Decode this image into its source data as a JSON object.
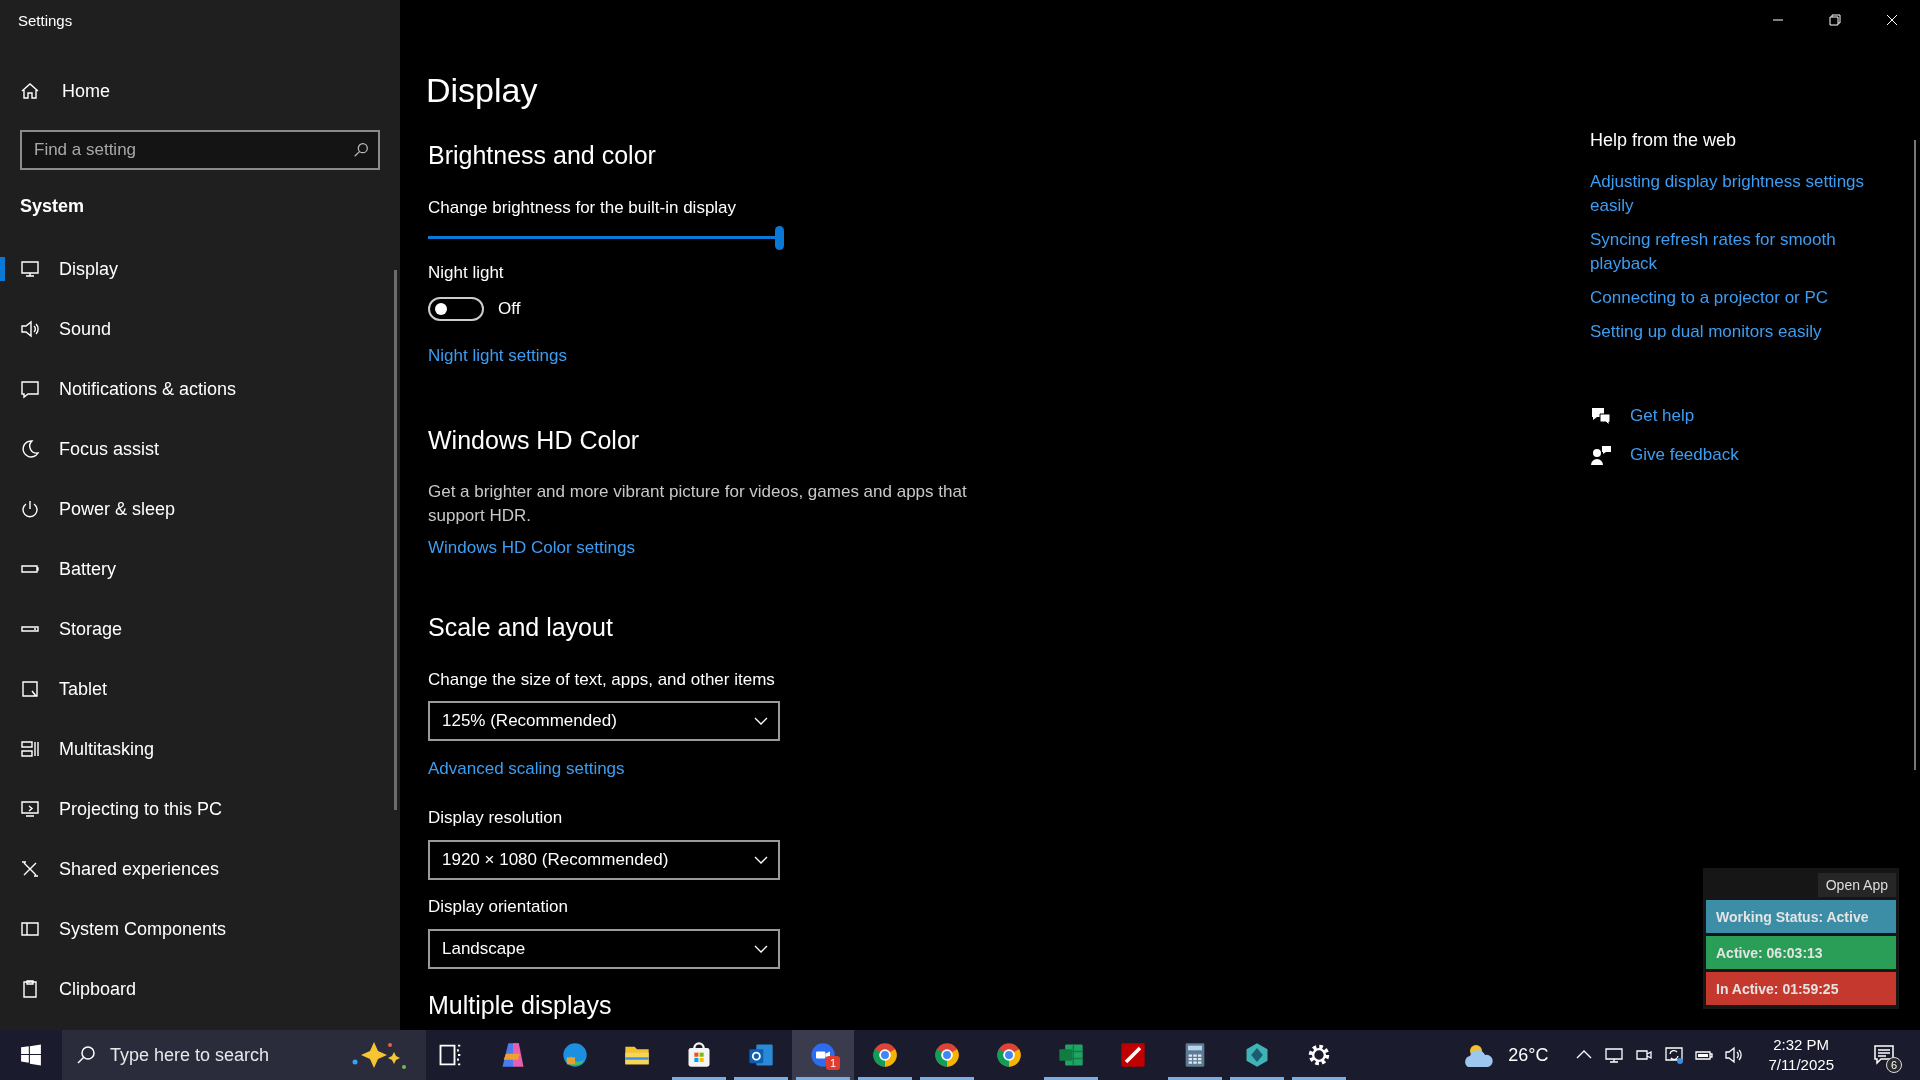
{
  "window": {
    "title": "Settings"
  },
  "sidebar": {
    "home": "Home",
    "search": {
      "placeholder": "Find a setting"
    },
    "section": "System",
    "items": [
      {
        "label": "Display",
        "selected": true
      },
      {
        "label": "Sound",
        "selected": false
      },
      {
        "label": "Notifications & actions",
        "selected": false
      },
      {
        "label": "Focus assist",
        "selected": false
      },
      {
        "label": "Power & sleep",
        "selected": false
      },
      {
        "label": "Battery",
        "selected": false
      },
      {
        "label": "Storage",
        "selected": false
      },
      {
        "label": "Tablet",
        "selected": false
      },
      {
        "label": "Multitasking",
        "selected": false
      },
      {
        "label": "Projecting to this PC",
        "selected": false
      },
      {
        "label": "Shared experiences",
        "selected": false
      },
      {
        "label": "System Components",
        "selected": false
      },
      {
        "label": "Clipboard",
        "selected": false
      }
    ]
  },
  "page": {
    "title": "Display",
    "brightness": {
      "heading": "Brightness and color",
      "label": "Change brightness for the built-in display",
      "level": 1.0
    },
    "night_light": {
      "label": "Night light",
      "on": false,
      "state": "Off",
      "link": "Night light settings"
    },
    "hd_color": {
      "heading": "Windows HD Color",
      "description": "Get a brighter and more vibrant picture for videos, games and apps that support HDR.",
      "link": "Windows HD Color settings"
    },
    "scale": {
      "heading": "Scale and layout",
      "size_label": "Change the size of text, apps, and other items",
      "size_value": "125% (Recommended)",
      "advanced_link": "Advanced scaling settings",
      "resolution_label": "Display resolution",
      "resolution_value": "1920 × 1080 (Recommended)",
      "orientation_label": "Display orientation",
      "orientation_value": "Landscape"
    },
    "next_heading": "Multiple displays"
  },
  "help": {
    "heading": "Help from the web",
    "links": [
      "Adjusting display brightness settings easily",
      "Syncing refresh rates for smooth playback",
      "Connecting to a projector or PC",
      "Setting up dual monitors easily"
    ],
    "get_help": "Get help",
    "feedback": "Give feedback"
  },
  "widget": {
    "button": "Open App",
    "statuses": [
      {
        "text": "Working Status: Active",
        "color": "#3b8ea6"
      },
      {
        "text": "Active: 06:03:13",
        "color": "#2a9d57"
      },
      {
        "text": "In Active: 01:59:25",
        "color": "#c5382e"
      }
    ]
  },
  "taskbar": {
    "search": {
      "placeholder": "Type here to search"
    },
    "apps": [
      {
        "kind": "taskview",
        "running": false,
        "selected": false
      },
      {
        "kind": "copilot",
        "running": false,
        "selected": false
      },
      {
        "kind": "edge",
        "running": false,
        "selected": false
      },
      {
        "kind": "folder",
        "running": false,
        "selected": false
      },
      {
        "kind": "store",
        "running": true,
        "selected": false
      },
      {
        "kind": "outlook",
        "running": true,
        "selected": false
      },
      {
        "kind": "zoom",
        "running": true,
        "selected": true,
        "badge": "1"
      },
      {
        "kind": "chrome",
        "running": true,
        "selected": false
      },
      {
        "kind": "chrome",
        "running": true,
        "selected": false
      },
      {
        "kind": "chrome",
        "running": false,
        "selected": false
      },
      {
        "kind": "excel",
        "running": true,
        "selected": false
      },
      {
        "kind": "filezilla",
        "running": false,
        "selected": false
      },
      {
        "kind": "calculator",
        "running": true,
        "selected": false
      },
      {
        "kind": "gem",
        "running": true,
        "selected": false
      },
      {
        "kind": "settings",
        "running": true,
        "selected": false
      }
    ],
    "temperature": "26°C",
    "time": "2:32 PM",
    "date": "7/11/2025",
    "notifications": "6"
  }
}
